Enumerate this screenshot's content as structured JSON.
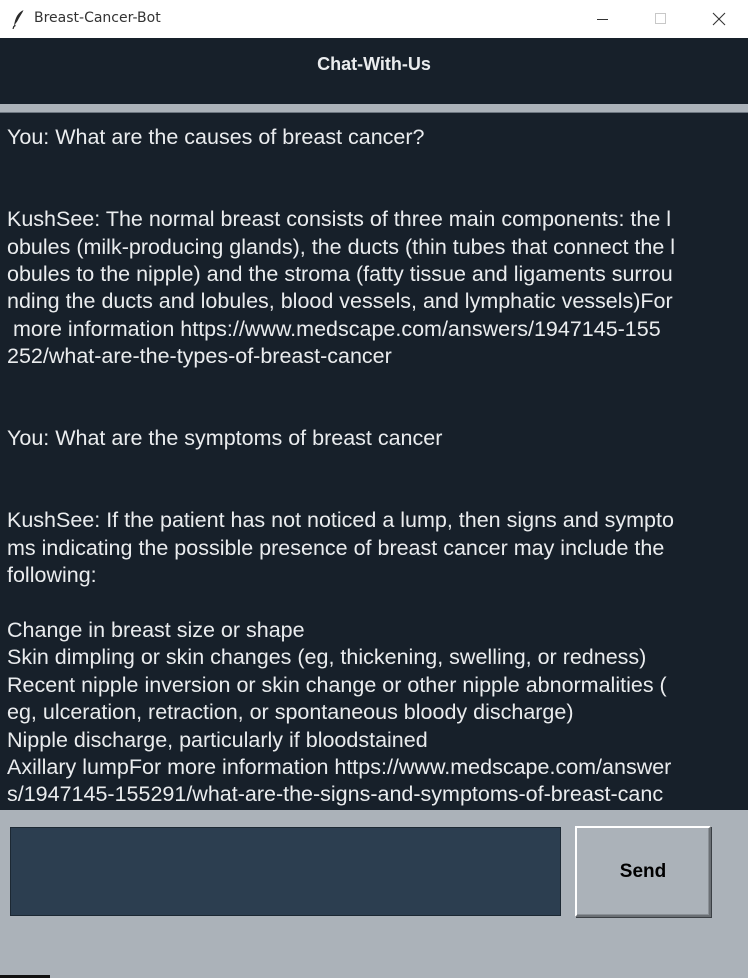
{
  "window": {
    "title": "Breast-Cancer-Bot",
    "icon": "feather-icon"
  },
  "header": {
    "title": "Chat-With-Us"
  },
  "chat": {
    "lines": [
      "You: What are the causes of breast cancer?",
      "",
      "",
      "KushSee: The normal breast consists of three main components: the l",
      "obules (milk-producing glands), the ducts (thin tubes that connect the l",
      "obules to the nipple) and the stroma (fatty tissue and ligaments surrou",
      "nding the ducts and lobules, blood vessels, and lymphatic vessels)For",
      " more information https://www.medscape.com/answers/1947145-155",
      "252/what-are-the-types-of-breast-cancer",
      "",
      "",
      "You: What are the symptoms of breast cancer",
      "",
      "",
      "KushSee: If the patient has not noticed a lump, then signs and sympto",
      "ms indicating the possible presence of breast cancer may include the",
      "following:",
      "",
      "Change in breast size or shape",
      "Skin dimpling or skin changes (eg, thickening, swelling, or redness)",
      "Recent nipple inversion or skin change or other nipple abnormalities (",
      "eg, ulceration, retraction, or spontaneous bloody discharge)",
      "Nipple discharge, particularly if bloodstained",
      "Axillary lumpFor more information https://www.medscape.com/answer",
      "s/1947145-155291/what-are-the-signs-and-symptoms-of-breast-canc"
    ]
  },
  "input": {
    "value": ""
  },
  "send_button": {
    "label": "Send"
  },
  "colors": {
    "background": "#17202A",
    "text": "#EAECEE",
    "entry": "#2C3E50",
    "frame": "#ABB2B9"
  }
}
